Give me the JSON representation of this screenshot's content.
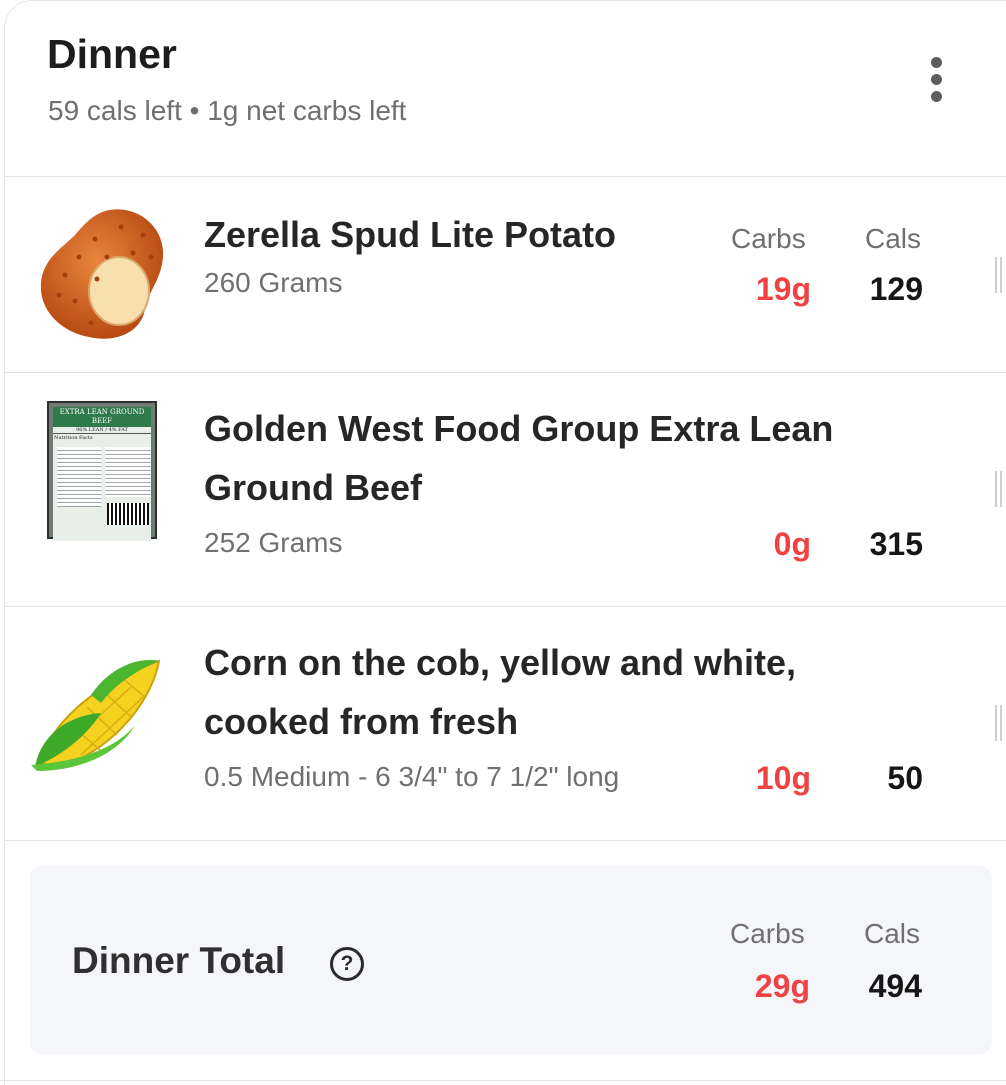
{
  "meal": {
    "title": "Dinner",
    "cals_left": "59 cals left",
    "separator": "•",
    "carbs_left": "1g net carbs left",
    "menu_icon": "more-vertical-icon"
  },
  "columns": {
    "carbs": "Carbs",
    "cals": "Cals"
  },
  "items": [
    {
      "name_line1": "Zerella Spud Lite Potato",
      "name_line2": "",
      "serving": "260 Grams",
      "carbs": "19g",
      "cals": "129",
      "image": "potato-icon"
    },
    {
      "name_line1": "Golden West Food Group Extra Lean",
      "name_line2": "Ground Beef",
      "serving": "252 Grams",
      "carbs": "0g",
      "cals": "315",
      "image": "ground-beef-package",
      "package_text": "EXTRA LEAN GROUND BEEF",
      "package_sub": "96% LEAN / 4% FAT",
      "package_panel": "Nutrition Facts"
    },
    {
      "name_line1": "Corn on the cob, yellow and white,",
      "name_line2": "cooked from fresh",
      "serving": "0.5 Medium - 6 3/4\" to 7 1/2\" long",
      "carbs": "10g",
      "cals": "50",
      "image": "corn-icon"
    }
  ],
  "total": {
    "label": "Dinner Total",
    "help_icon": "question-circle-icon",
    "help_glyph": "?",
    "carbs": "29g",
    "cals": "494"
  },
  "colors": {
    "carbs": "#ef4242",
    "total_bg": "#f4f6fa",
    "divider": "#e3e3e3"
  }
}
